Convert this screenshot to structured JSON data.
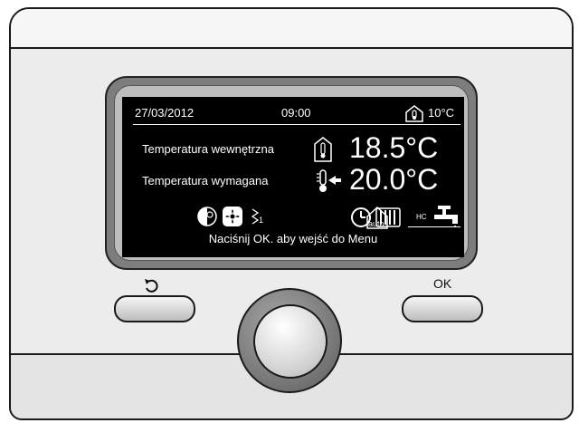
{
  "header": {
    "date": "27/03/2012",
    "time": "09:00",
    "outdoor_temp": "10°C"
  },
  "readings": {
    "room_label": "Temperatura wewnętrzna",
    "room_value": "18.5°C",
    "setpoint_label": "Temperatura wymagana",
    "setpoint_value": "20.0°C"
  },
  "status": {
    "zone_number": "1",
    "mode_text": "auto",
    "hc_label": "HC"
  },
  "hint": "Naciśnij OK. aby wejść do Menu",
  "buttons": {
    "ok_label": "OK"
  },
  "icons": [
    "outdoor-house-thermometer-icon",
    "room-thermometer-icon",
    "setpoint-thermometer-icon",
    "sun-moon-icon",
    "fan-icon",
    "zone-icon",
    "auto-house-icon",
    "clock-icon",
    "radiator-icon",
    "hot-water-tap-icon",
    "back-arrow-icon"
  ],
  "colors": {
    "lcd_background": "#000000",
    "lcd_text": "#ffffff",
    "housing": "#ececec"
  }
}
